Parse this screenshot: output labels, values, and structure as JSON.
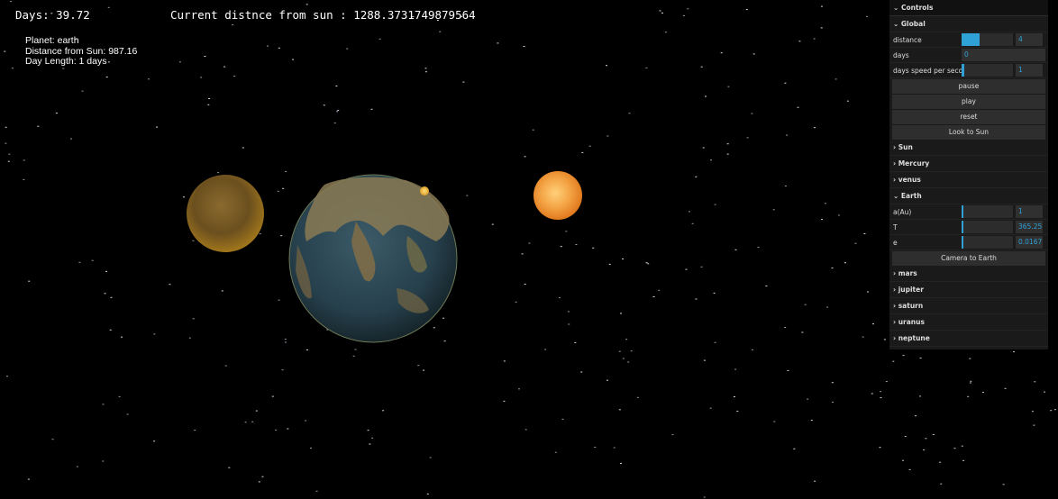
{
  "hud": {
    "days": "Days: 39.72",
    "distance": "Current distnce from sun : 1288.3731749879564"
  },
  "planet_info": {
    "planet": "Planet: earth",
    "distance": "Distance from Sun: 987.16",
    "day_length": "Day Length: 1 days"
  },
  "controls": {
    "title": "Controls",
    "global": {
      "title": "Global",
      "distance_label": "distance",
      "distance_value": "4",
      "distance_fill": 0.35,
      "days_label": "days",
      "days_value": "0",
      "speed_label": "days speed per second",
      "speed_value": "1",
      "speed_fill": 0.05,
      "pause": "pause",
      "play": "play",
      "reset": "reset",
      "look_to_sun": "Look to Sun"
    },
    "sun": "Sun",
    "mercury": "Mercury",
    "venus": "venus",
    "earth": {
      "title": "Earth",
      "a_label": "a(Au)",
      "a_value": "1",
      "a_fill": 0.03,
      "t_label": "T",
      "t_value": "365.25",
      "t_fill": 0.03,
      "e_label": "e",
      "e_value": "0.0167",
      "e_fill": 0.02,
      "camera": "Camera to Earth"
    },
    "mars": "mars",
    "jupiter": "jupiter",
    "saturn": "saturn",
    "uranus": "uranus",
    "neptune": "neptune"
  },
  "colors": {
    "accent": "#2fa1d6",
    "panel_bg": "#1a1a1a",
    "space": "#000000"
  }
}
